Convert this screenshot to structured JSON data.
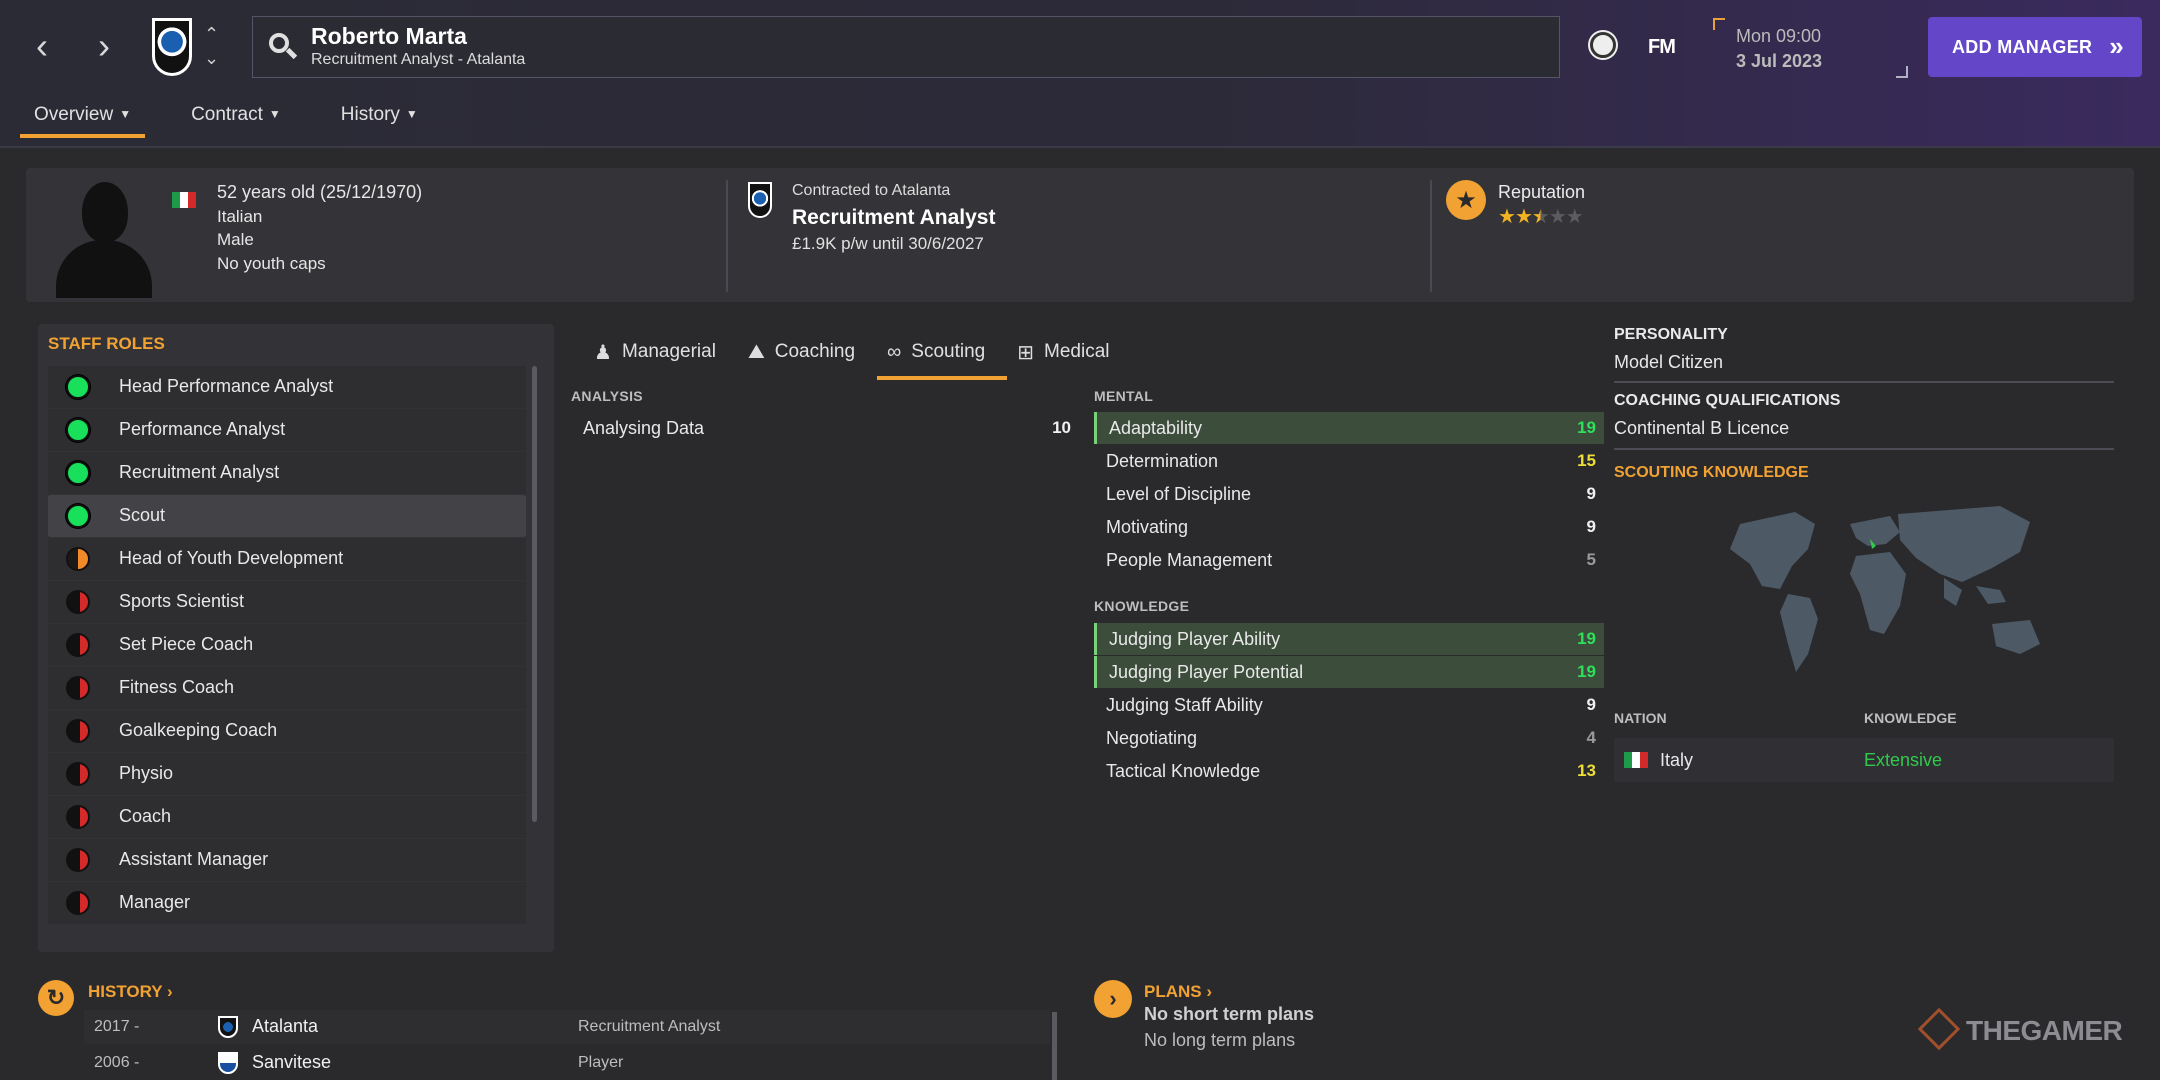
{
  "header": {
    "person_name": "Roberto Marta",
    "person_subtitle": "Recruitment Analyst - Atalanta",
    "fm_logo": "FM",
    "date_time": "Mon 09:00",
    "date_day": "3 Jul 2023",
    "add_manager_label": "ADD MANAGER",
    "back_icon": "chevron-left",
    "forward_icon": "chevron-right",
    "accent": "#6446c8"
  },
  "tabs": [
    {
      "label": "Overview",
      "active": true
    },
    {
      "label": "Contract",
      "active": false
    },
    {
      "label": "History",
      "active": false
    }
  ],
  "info": {
    "age_line": "52 years old (25/12/1970)",
    "nationality": "Italian",
    "gender": "Male",
    "caps": "No youth caps",
    "contract_label": "Contracted to Atalanta",
    "contract_role": "Recruitment Analyst",
    "contract_wage": "£1.9K p/w until 30/6/2027",
    "reputation_label": "Reputation",
    "reputation_stars": 2.5,
    "reputation_max": 5
  },
  "staff_roles": {
    "title": "STAFF ROLES",
    "items": [
      {
        "label": "Head Performance Analyst",
        "suitability": "full"
      },
      {
        "label": "Performance Analyst",
        "suitability": "full"
      },
      {
        "label": "Recruitment Analyst",
        "suitability": "full"
      },
      {
        "label": "Scout",
        "suitability": "full",
        "selected": true
      },
      {
        "label": "Head of Youth Development",
        "suitability": "half"
      },
      {
        "label": "Sports Scientist",
        "suitability": "none"
      },
      {
        "label": "Set Piece Coach",
        "suitability": "none"
      },
      {
        "label": "Fitness Coach",
        "suitability": "none"
      },
      {
        "label": "Goalkeeping Coach",
        "suitability": "none"
      },
      {
        "label": "Physio",
        "suitability": "none"
      },
      {
        "label": "Coach",
        "suitability": "none"
      },
      {
        "label": "Assistant Manager",
        "suitability": "none"
      },
      {
        "label": "Manager",
        "suitability": "none"
      }
    ]
  },
  "attribute_tabs": [
    {
      "label": "Managerial",
      "icon": "managerial-icon",
      "active": false
    },
    {
      "label": "Coaching",
      "icon": "coaching-icon",
      "active": false
    },
    {
      "label": "Scouting",
      "icon": "binoculars-icon",
      "active": true
    },
    {
      "label": "Medical",
      "icon": "medical-kit-icon",
      "active": false
    }
  ],
  "analysis": {
    "title": "ANALYSIS",
    "items": [
      {
        "name": "Analysing Data",
        "value": "10"
      }
    ]
  },
  "mental": {
    "title": "MENTAL",
    "items": [
      {
        "name": "Adaptability",
        "value": "19"
      },
      {
        "name": "Determination",
        "value": "15"
      },
      {
        "name": "Level of Discipline",
        "value": "9"
      },
      {
        "name": "Motivating",
        "value": "9"
      },
      {
        "name": "People Management",
        "value": "5"
      }
    ]
  },
  "knowledge": {
    "title": "KNOWLEDGE",
    "items": [
      {
        "name": "Judging Player Ability",
        "value": "19"
      },
      {
        "name": "Judging Player Potential",
        "value": "19"
      },
      {
        "name": "Judging Staff Ability",
        "value": "9"
      },
      {
        "name": "Negotiating",
        "value": "4"
      },
      {
        "name": "Tactical Knowledge",
        "value": "13"
      }
    ]
  },
  "right_panel": {
    "personality_title": "PERSONALITY",
    "personality_value": "Model Citizen",
    "qualifications_title": "COACHING QUALIFICATIONS",
    "qualifications_value": "Continental B Licence",
    "scouting_knowledge_title": "SCOUTING KNOWLEDGE",
    "nation_header": "NATION",
    "knowledge_header": "KNOWLEDGE",
    "nation": "Italy",
    "knowledge_level": "Extensive"
  },
  "history": {
    "title": "HISTORY",
    "rows": [
      {
        "year": "2017 -",
        "club": "Atalanta",
        "role": "Recruitment Analyst"
      },
      {
        "year": "2006 -",
        "club": "Sanvitese",
        "role": "Player"
      }
    ]
  },
  "plans": {
    "title": "PLANS",
    "short": "No short term plans",
    "long": "No long term plans"
  },
  "watermark": "THEGAMER"
}
